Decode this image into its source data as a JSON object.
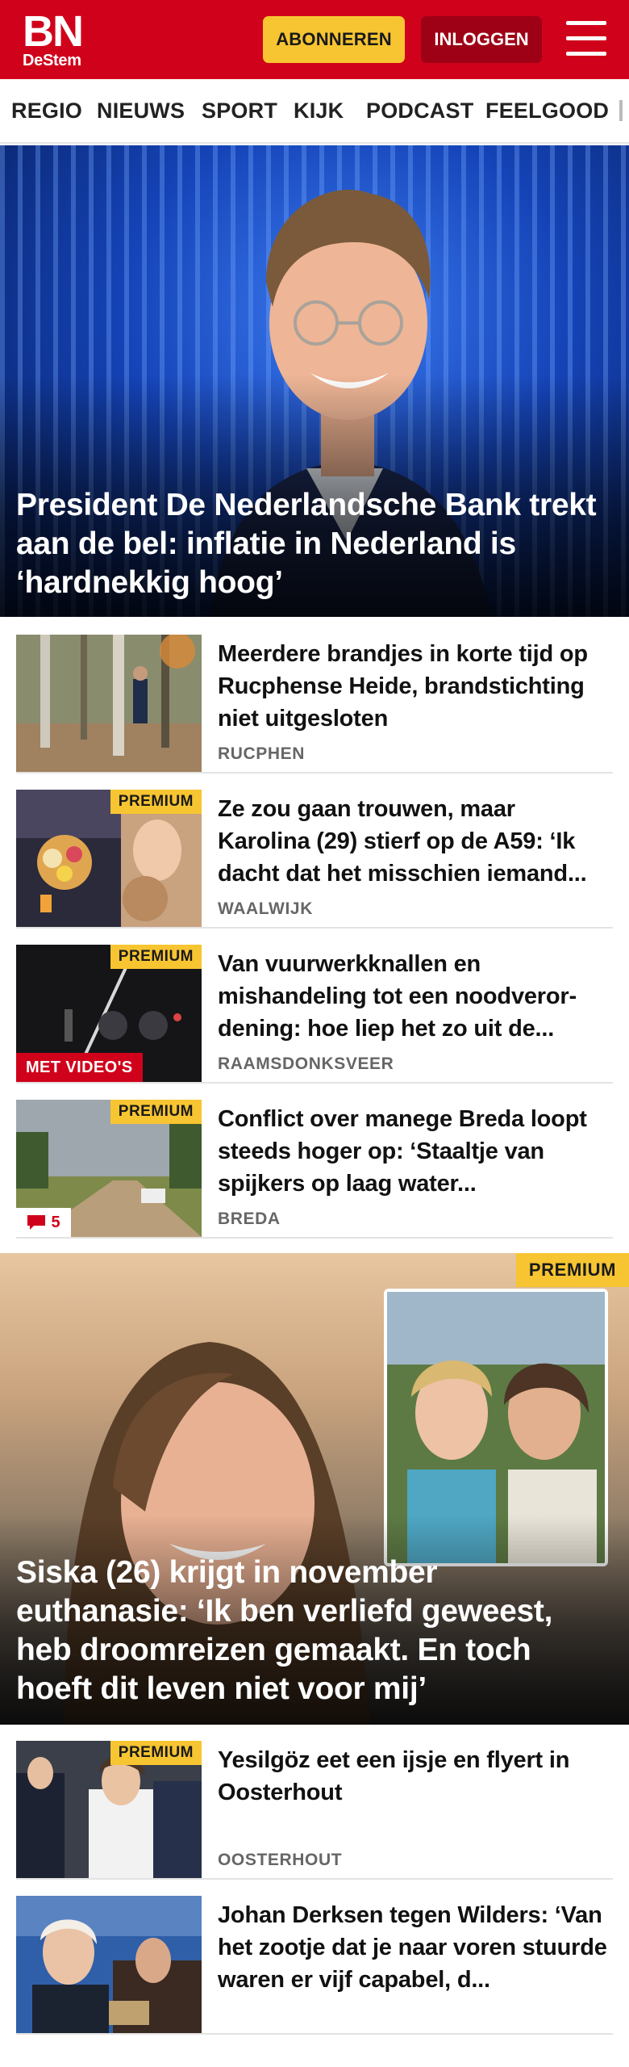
{
  "header": {
    "logo_main": "BN",
    "logo_sub": "DeStem",
    "subscribe_label": "ABONNEREN",
    "login_label": "INLOGGEN",
    "brand_color": "#d0021b"
  },
  "nav": {
    "items": [
      "REGIO",
      "NIEUWS",
      "SPORT",
      "KIJK",
      "PODCAST",
      "FEELGOOD"
    ]
  },
  "hero": {
    "title": "President De Nederlandsche Bank trekt aan de bel: inflatie in Nederland is ‘hardnekkig hoog’"
  },
  "articles": [
    {
      "title": "Meerdere brandjes in korte tijd op Rucphense Heide, brandstich­ting niet uitgesloten",
      "label": "RUCPHEN",
      "premium": false
    },
    {
      "title": "Ze zou gaan trouwen, maar Karolina (29) stierf op de A59: ‘Ik dacht dat het misschien iemand...",
      "label": "WAALWIJK",
      "premium": true,
      "premium_label": "PREMIUM"
    },
    {
      "title": "Van vuurwerkknallen en mishandeling tot een noodveror­dening: hoe liep het zo uit de...",
      "label": "RAAMSDONKSVEER",
      "premium": true,
      "premium_label": "PREMIUM",
      "video_label": "MET VIDEO'S"
    },
    {
      "title": "Conflict over manege Breda loopt steeds hoger op: ‘Staaltje van spijkers op laag water...",
      "label": "BREDA",
      "premium": true,
      "premium_label": "PREMIUM",
      "comments": "5"
    }
  ],
  "feature": {
    "premium_label": "PREMIUM",
    "title": "Siska (26) krijgt in november euthanasie: ‘Ik ben verliefd geweest, heb droomreizen gemaakt. En toch hoeft dit leven niet voor mij’"
  },
  "articles2": [
    {
      "title": "Yesilgöz eet een ijsje en flyert in Oosterhout",
      "label": "OOSTERHOUT",
      "premium": true,
      "premium_label": "PREMIUM"
    },
    {
      "title": "Johan Derksen tegen Wilders: ‘Van het zootje dat je naar voren stuurde waren er vijf capabel, d...",
      "label": "",
      "premium": false
    }
  ]
}
